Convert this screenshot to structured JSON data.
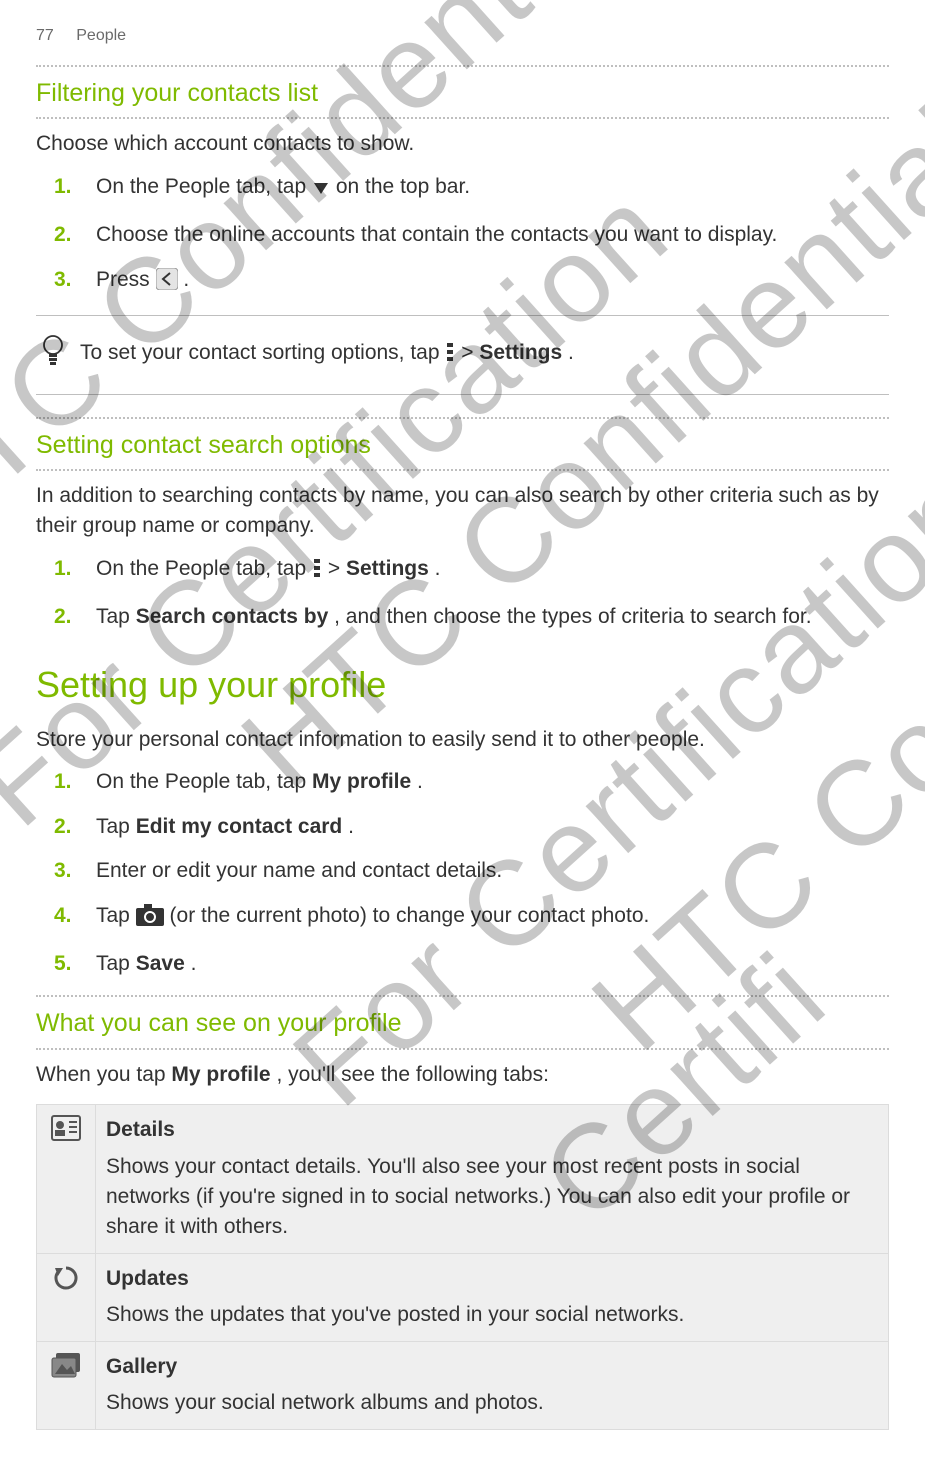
{
  "page_header": {
    "page_num": "77",
    "section": "People"
  },
  "watermarks": {
    "a": "HTC Confidential",
    "b": "For Certification",
    "c": "HTC Confidential",
    "d": "For Certification",
    "e": "HTC Confide",
    "f": "Certifi"
  },
  "section_a": {
    "heading": "Filtering your contacts list",
    "intro": "Choose which account contacts to show.",
    "steps": {
      "s1_pre": "On the People tab, tap ",
      "s1_post": " on the top bar.",
      "s2": "Choose the online accounts that contain the contacts you want to display.",
      "s3_pre": "Press ",
      "s3_post": "."
    },
    "tip_pre": "To set your contact sorting options, tap ",
    "tip_mid": " > ",
    "tip_link": "Settings",
    "tip_post": "."
  },
  "section_b": {
    "heading": "Setting contact search options",
    "intro": "In addition to searching contacts by name, you can also search by other criteria such as by their group name or company.",
    "steps": {
      "s1_pre": "On the People tab, tap ",
      "s1_mid": " > ",
      "s1_link": "Settings",
      "s1_post": ".",
      "s2_pre": "Tap ",
      "s2_link": "Search contacts by",
      "s2_post": ", and then choose the types of criteria to search for."
    }
  },
  "section_c": {
    "heading": "Setting up your profile",
    "intro": "Store your personal contact information to easily send it to other people.",
    "steps": {
      "s1_pre": "On the People tab, tap ",
      "s1_link": "My profile",
      "s1_post": ".",
      "s2_pre": "Tap ",
      "s2_link": "Edit my contact card",
      "s2_post": ".",
      "s3": "Enter or edit your name and contact details.",
      "s4_pre": "Tap ",
      "s4_post": " (or the current photo) to change your contact photo.",
      "s5_pre": "Tap ",
      "s5_link": "Save",
      "s5_post": "."
    }
  },
  "section_d": {
    "heading": "What you can see on your profile",
    "intro_pre": "When you tap ",
    "intro_link": "My profile",
    "intro_post": ", you'll see the following tabs:",
    "tabs": {
      "details": {
        "title": "Details",
        "body": "Shows your contact details. You'll also see your most recent posts in social networks (if you're signed in to social networks.) You can also edit your profile or share it with others."
      },
      "updates": {
        "title": "Updates",
        "body": "Shows the updates that you've posted in your social networks."
      },
      "gallery": {
        "title": "Gallery",
        "body": "Shows your social network albums and photos."
      }
    }
  },
  "nums": {
    "n1": "1.",
    "n2": "2.",
    "n3": "3.",
    "n4": "4.",
    "n5": "5."
  }
}
